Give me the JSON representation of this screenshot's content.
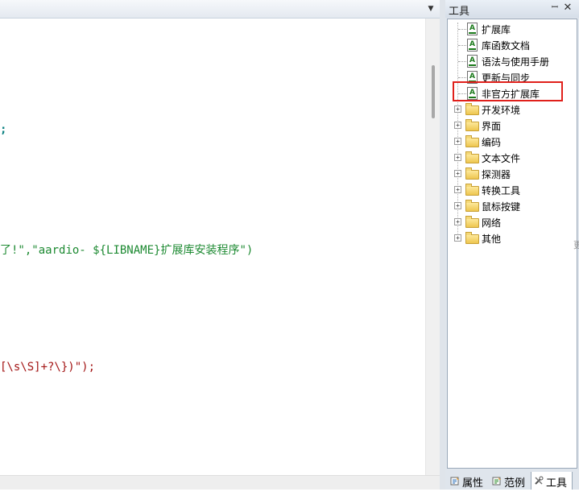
{
  "panel": {
    "title": "工具"
  },
  "tree": {
    "items": [
      {
        "label": "扩展库",
        "kind": "doc",
        "icon": "document-icon"
      },
      {
        "label": "库函数文档",
        "kind": "doc",
        "icon": "document-icon"
      },
      {
        "label": "语法与使用手册",
        "kind": "doc",
        "icon": "document-icon"
      },
      {
        "label": "更新与同步",
        "kind": "doc",
        "icon": "document-icon"
      },
      {
        "label": "非官方扩展库",
        "kind": "doc",
        "icon": "document-icon",
        "highlighted": true
      },
      {
        "label": "开发环境",
        "kind": "folder",
        "icon": "folder-icon"
      },
      {
        "label": "界面",
        "kind": "folder",
        "icon": "folder-icon"
      },
      {
        "label": "编码",
        "kind": "folder",
        "icon": "folder-icon"
      },
      {
        "label": "文本文件",
        "kind": "folder",
        "icon": "folder-icon"
      },
      {
        "label": "探测器",
        "kind": "folder",
        "icon": "folder-icon"
      },
      {
        "label": "转换工具",
        "kind": "folder",
        "icon": "folder-icon"
      },
      {
        "label": "鼠标按键",
        "kind": "folder",
        "icon": "folder-icon"
      },
      {
        "label": "网络",
        "kind": "folder",
        "icon": "folder-icon"
      },
      {
        "label": "其他",
        "kind": "folder",
        "icon": "folder-icon"
      }
    ]
  },
  "tabs": [
    {
      "label": "属性",
      "icon": "properties-icon",
      "active": false
    },
    {
      "label": "范例",
      "icon": "examples-icon",
      "active": false
    },
    {
      "label": "工具",
      "icon": "tools-icon",
      "active": true
    }
  ],
  "editor": {
    "line1": ";",
    "line2_a": "了!\",",
    "line2_b": "\"aardio- ${LIBNAME}扩展库安装程序\")",
    "line3": "[\\s\\S]+?\\})\");",
    "edge_char": "更"
  },
  "colors": {
    "highlight": "#e0201b",
    "string_green": "#1d8a32",
    "regex_red": "#a31515"
  }
}
